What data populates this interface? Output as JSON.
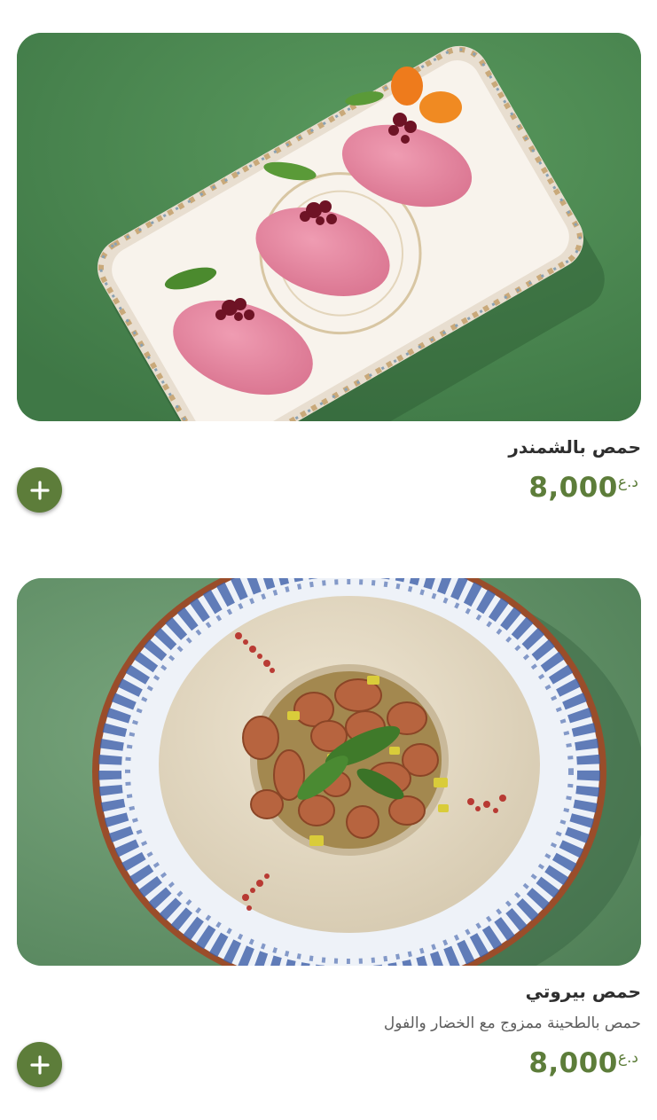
{
  "menu_items": [
    {
      "name": "حمص بالشمندر",
      "description": "",
      "price": "8,000",
      "currency": "د.ع",
      "image_alt": "beetroot hummus on a rectangular patterned plate",
      "add_icon": "plus-icon"
    },
    {
      "name": "حمص بيروتي",
      "description": "حمص بالطحينة ممزوج مع الخضار والفول",
      "price": "8,000",
      "currency": "د.ع",
      "image_alt": "beiruti hummus ring with fava beans on blue patterned plate",
      "add_icon": "plus-icon"
    }
  ],
  "colors": {
    "accent": "#5d7d3a",
    "background": "#ffffff",
    "title_text": "#2e2e2e",
    "description_text": "#5c5c5c"
  }
}
